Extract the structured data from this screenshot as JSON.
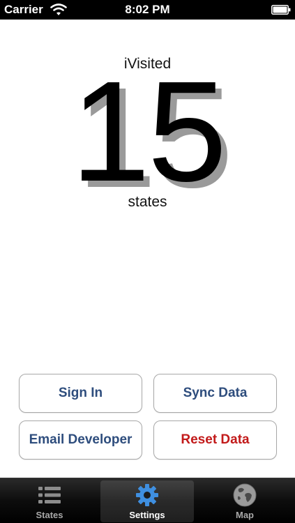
{
  "status_bar": {
    "carrier": "Carrier",
    "time": "8:02 PM",
    "wifi_icon": "wifi-icon",
    "battery_icon": "battery-icon"
  },
  "main": {
    "title": "iVisited",
    "count": "15",
    "unit": "states"
  },
  "buttons": {
    "sign_in": "Sign In",
    "sync_data": "Sync Data",
    "email_developer": "Email Developer",
    "reset_data": "Reset Data"
  },
  "tabs": [
    {
      "label": "States",
      "icon": "list-icon",
      "selected": false
    },
    {
      "label": "Settings",
      "icon": "gear-icon",
      "selected": true
    },
    {
      "label": "Map",
      "icon": "globe-icon",
      "selected": false
    }
  ],
  "colors": {
    "button_text": "#2e4d7d",
    "reset_text": "#c21a1a",
    "gear_blue": "#3f8fe0"
  }
}
